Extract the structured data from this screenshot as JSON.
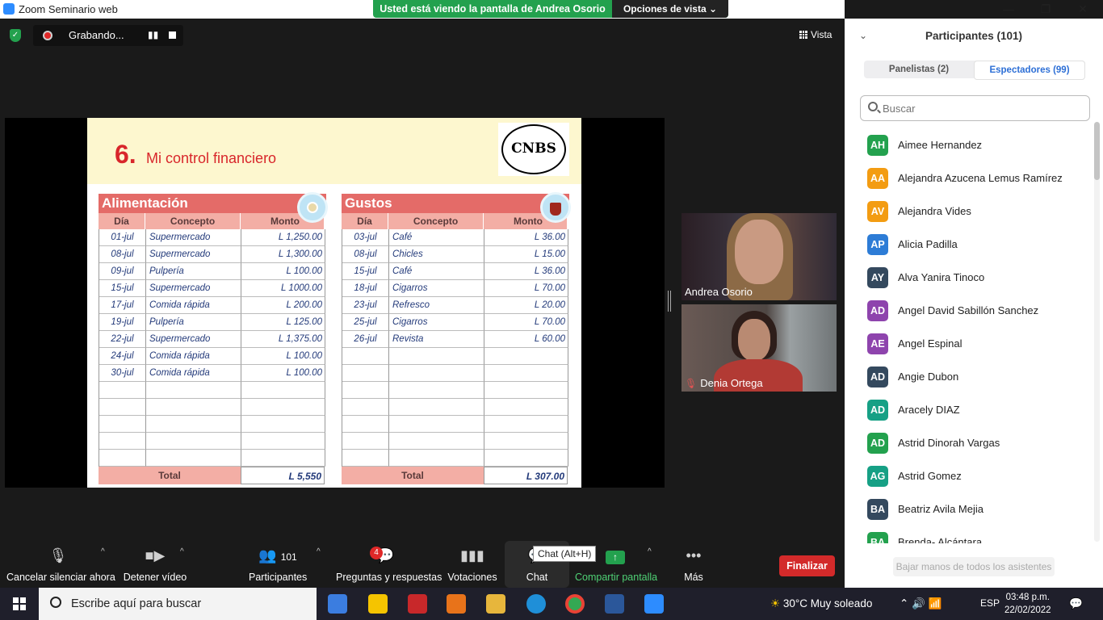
{
  "window": {
    "app_title": "Zoom Seminario web",
    "share_notice": "Usted está viendo la pantalla de Andrea Osorio",
    "view_options": "Opciones de vista",
    "minimize": "—",
    "maximize": "❐",
    "close": "✕"
  },
  "recording": {
    "label": "Grabando...",
    "pause": "▮▮"
  },
  "vista": "Vista",
  "slide": {
    "number": "6.",
    "title": "Mi control financiero",
    "logo_text": "CNBS",
    "tables": [
      {
        "title": "Alimentación",
        "headers": [
          "Día",
          "Concepto",
          "Monto"
        ],
        "rows": [
          [
            "01-jul",
            "Supermercado",
            "L 1,250.00"
          ],
          [
            "08-jul",
            "Supermercado",
            "L 1,300.00"
          ],
          [
            "09-jul",
            "Pulpería",
            "L 100.00"
          ],
          [
            "15-jul",
            "Supermercado",
            "L 1000.00"
          ],
          [
            "17-jul",
            "Comida rápida",
            "L 200.00"
          ],
          [
            "19-jul",
            "Pulpería",
            "L 125.00"
          ],
          [
            "22-jul",
            "Supermercado",
            "L 1,375.00"
          ],
          [
            "24-jul",
            "Comida rápida",
            "L 100.00"
          ],
          [
            "30-jul",
            "Comida rápida",
            "L 100.00"
          ],
          [
            "",
            "",
            ""
          ],
          [
            "",
            "",
            ""
          ],
          [
            "",
            "",
            ""
          ],
          [
            "",
            "",
            ""
          ],
          [
            "",
            "",
            ""
          ]
        ],
        "total_label": "Total",
        "total_value": "L 5,550"
      },
      {
        "title": "Gustos",
        "headers": [
          "Día",
          "Concepto",
          "Monto"
        ],
        "rows": [
          [
            "03-jul",
            "Café",
            "L 36.00"
          ],
          [
            "08-jul",
            "Chicles",
            "L 15.00"
          ],
          [
            "15-jul",
            "Café",
            "L 36.00"
          ],
          [
            "18-jul",
            "Cigarros",
            "L 70.00"
          ],
          [
            "23-jul",
            "Refresco",
            "L 20.00"
          ],
          [
            "25-jul",
            "Cigarros",
            "L 70.00"
          ],
          [
            "26-jul",
            "Revista",
            "L 60.00"
          ],
          [
            "",
            "",
            ""
          ],
          [
            "",
            "",
            ""
          ],
          [
            "",
            "",
            ""
          ],
          [
            "",
            "",
            ""
          ],
          [
            "",
            "",
            ""
          ],
          [
            "",
            "",
            ""
          ],
          [
            "",
            "",
            ""
          ]
        ],
        "total_label": "Total",
        "total_value": "L 307.00"
      }
    ]
  },
  "videos": [
    {
      "name": "Andrea Osorio"
    },
    {
      "name": "Denia Ortega"
    }
  ],
  "toolbar": {
    "mute": "Cancelar silenciar ahora",
    "video": "Detener vídeo",
    "participants": "Participantes",
    "participants_count": "101",
    "qa": "Preguntas y respuestas",
    "qa_badge": "4",
    "polls": "Votaciones",
    "chat": "Chat",
    "chat_tooltip": "Chat (Alt+H)",
    "share": "Compartir pantalla",
    "more": "Más",
    "end": "Finalizar"
  },
  "panel": {
    "title": "Participantes (101)",
    "tab_panelists": "Panelistas (2)",
    "tab_attendees": "Espectadores (99)",
    "search_placeholder": "Buscar",
    "participants": [
      {
        "initials": "AH",
        "name": "Aimee Hernandez",
        "color": "#23a14e"
      },
      {
        "initials": "AA",
        "name": "Alejandra Azucena Lemus Ramírez",
        "color": "#f39c12"
      },
      {
        "initials": "AV",
        "name": "Alejandra Vides",
        "color": "#f39c12"
      },
      {
        "initials": "AP",
        "name": "Alicia Padilla",
        "color": "#2d7cd6"
      },
      {
        "initials": "AY",
        "name": "Alva Yanira Tinoco",
        "color": "#34495e"
      },
      {
        "initials": "AD",
        "name": "Angel David Sabillón Sanchez",
        "color": "#8e44ad"
      },
      {
        "initials": "AE",
        "name": "Angel Espinal",
        "color": "#8e44ad"
      },
      {
        "initials": "AD",
        "name": "Angie Dubon",
        "color": "#34495e"
      },
      {
        "initials": "AD",
        "name": "Aracely DIAZ",
        "color": "#16a085"
      },
      {
        "initials": "AD",
        "name": "Astrid Dinorah Vargas",
        "color": "#23a14e"
      },
      {
        "initials": "AG",
        "name": "Astrid Gomez",
        "color": "#16a085"
      },
      {
        "initials": "BA",
        "name": "Beatriz Avila Mejia",
        "color": "#34495e"
      },
      {
        "initials": "BA",
        "name": "Brenda- Alcántara",
        "color": "#23a14e"
      }
    ],
    "lower_hands": "Bajar manos de todos los asistentes"
  },
  "taskbar": {
    "search_placeholder": "Escribe aquí para buscar",
    "weather": "30°C  Muy soleado",
    "lang": "ESP",
    "time": "03:48 p.m.",
    "date": "22/02/2022"
  }
}
